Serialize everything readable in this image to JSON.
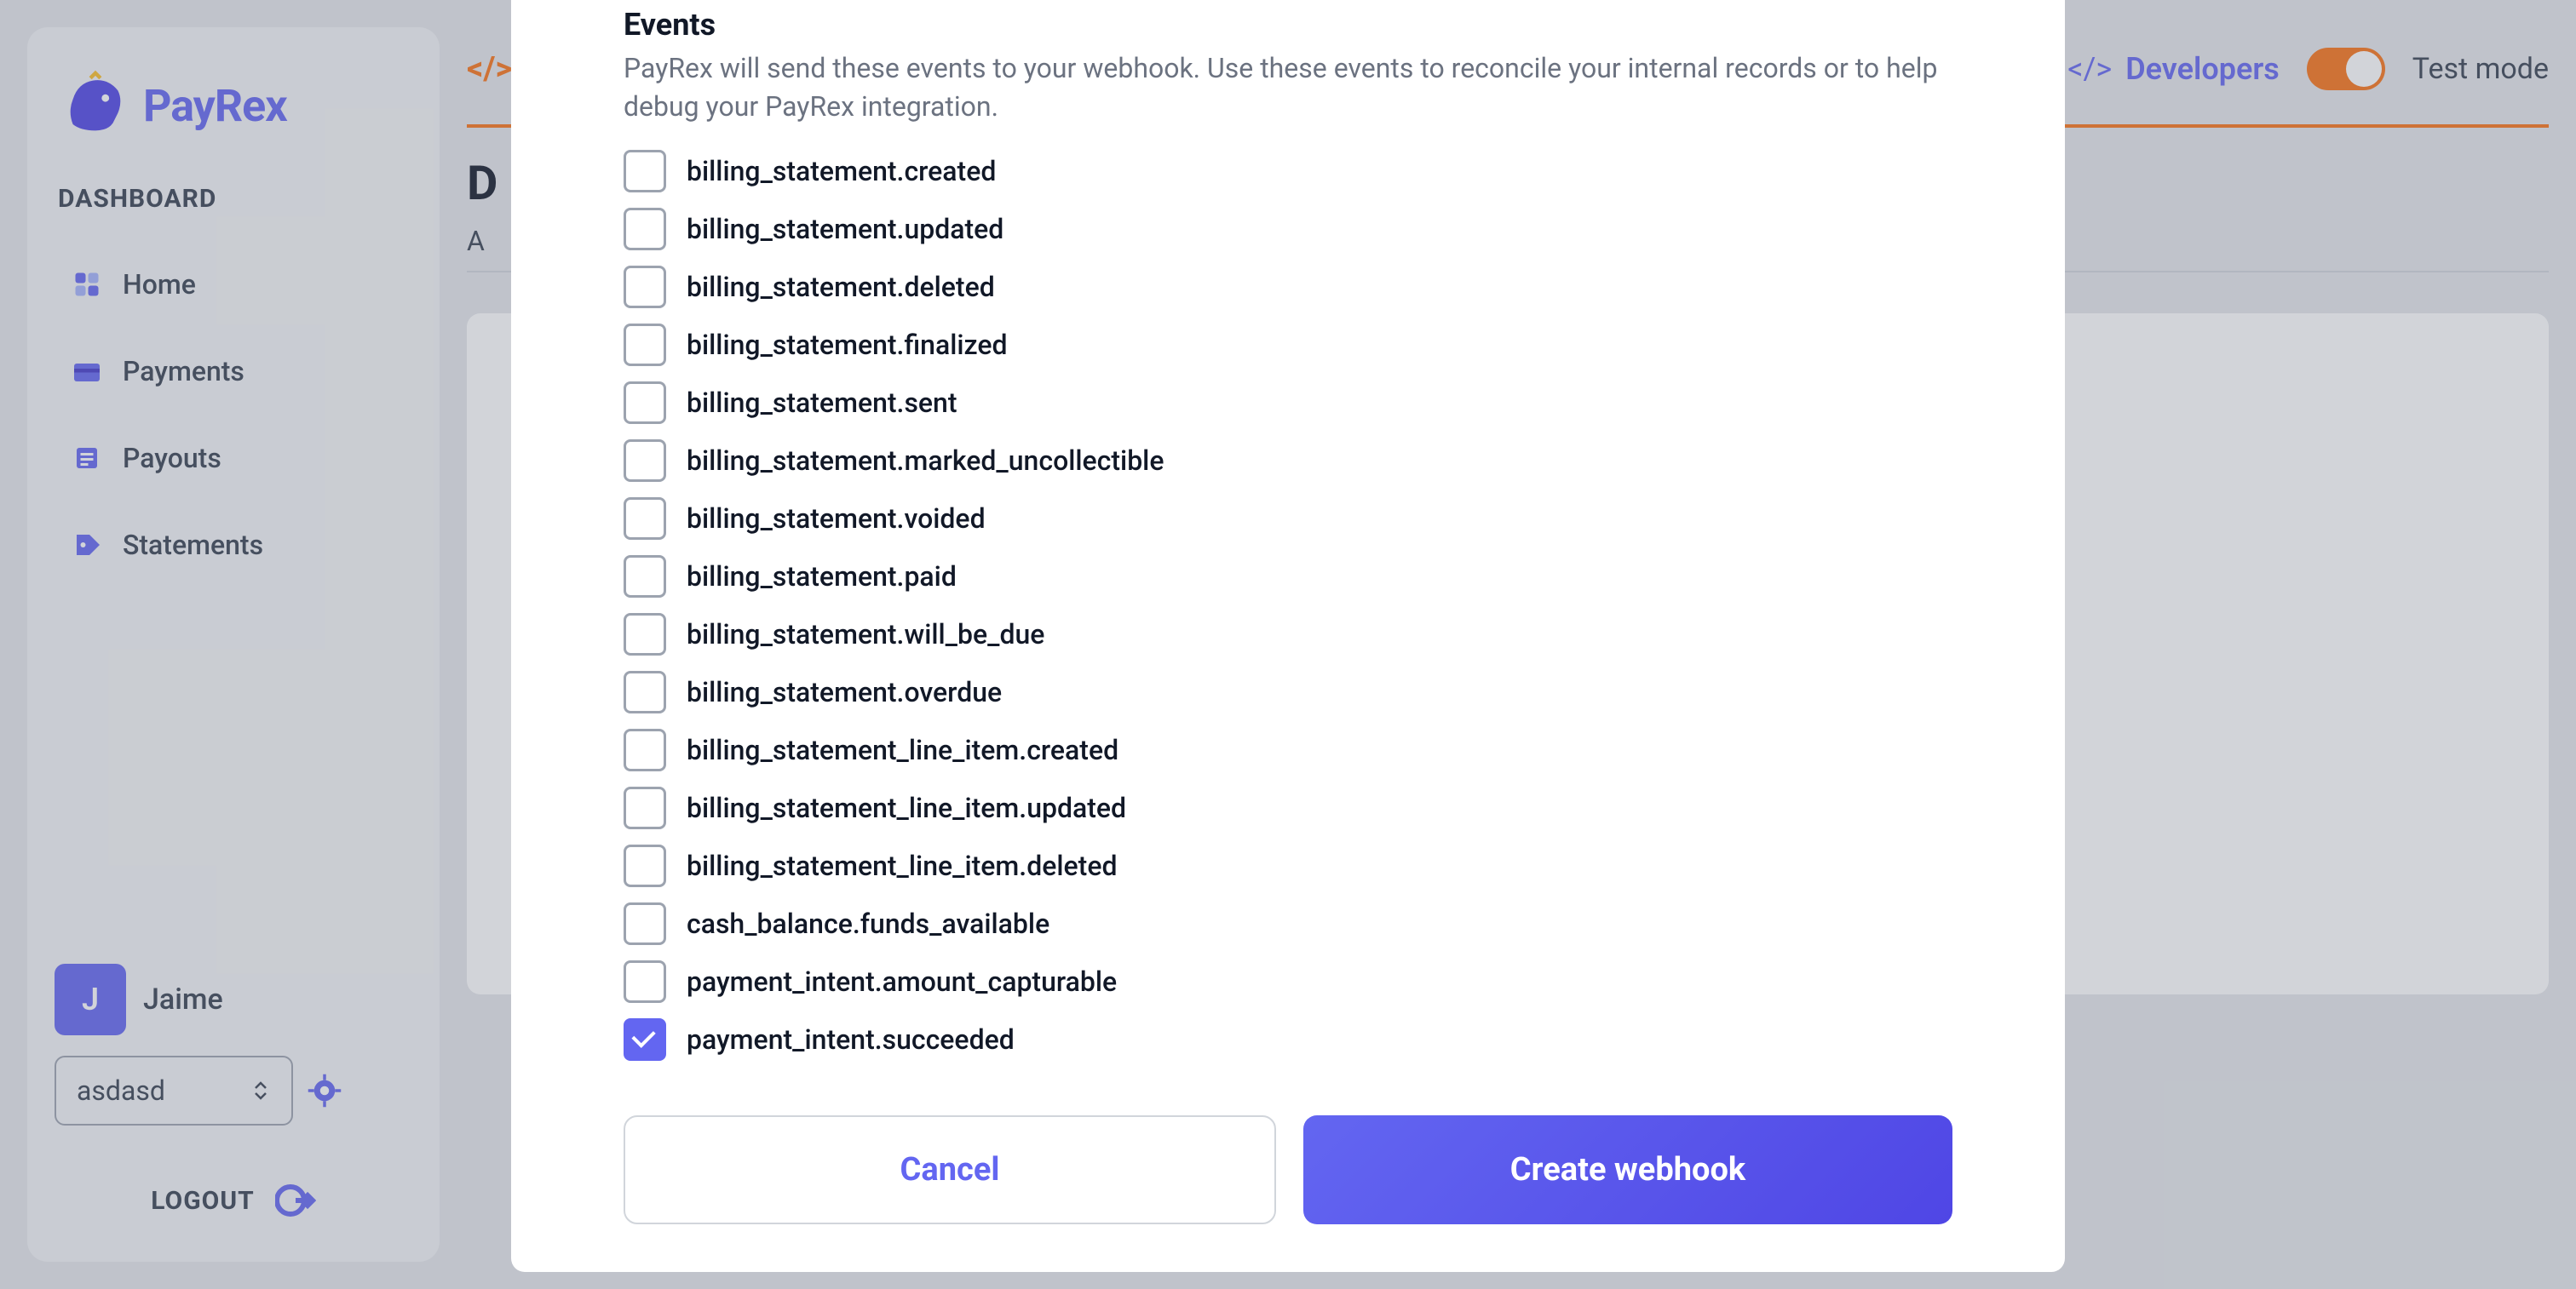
{
  "logo": {
    "text": "PayRex"
  },
  "sidebar": {
    "section_label": "DASHBOARD",
    "nav": [
      {
        "label": "Home",
        "icon": "home-icon"
      },
      {
        "label": "Payments",
        "icon": "card-icon"
      },
      {
        "label": "Payouts",
        "icon": "list-icon"
      },
      {
        "label": "Statements",
        "icon": "tag-icon"
      }
    ],
    "user": {
      "initial": "J",
      "name": "Jaime"
    },
    "selector_value": "asdasd",
    "logout_label": "LOGOUT"
  },
  "topbar": {
    "developers_label": "Developers",
    "test_mode_label": "Test mode"
  },
  "page": {
    "title_initial": "D",
    "tab_initial": "A"
  },
  "modal": {
    "events_title": "Events",
    "events_desc": "PayRex will send these events to your webhook. Use these events to reconcile your internal records or to help debug your PayRex integration.",
    "events": [
      {
        "name": "billing_statement.created",
        "checked": false
      },
      {
        "name": "billing_statement.updated",
        "checked": false
      },
      {
        "name": "billing_statement.deleted",
        "checked": false
      },
      {
        "name": "billing_statement.finalized",
        "checked": false
      },
      {
        "name": "billing_statement.sent",
        "checked": false
      },
      {
        "name": "billing_statement.marked_uncollectible",
        "checked": false
      },
      {
        "name": "billing_statement.voided",
        "checked": false
      },
      {
        "name": "billing_statement.paid",
        "checked": false
      },
      {
        "name": "billing_statement.will_be_due",
        "checked": false
      },
      {
        "name": "billing_statement.overdue",
        "checked": false
      },
      {
        "name": "billing_statement_line_item.created",
        "checked": false
      },
      {
        "name": "billing_statement_line_item.updated",
        "checked": false
      },
      {
        "name": "billing_statement_line_item.deleted",
        "checked": false
      },
      {
        "name": "cash_balance.funds_available",
        "checked": false
      },
      {
        "name": "payment_intent.amount_capturable",
        "checked": false
      },
      {
        "name": "payment_intent.succeeded",
        "checked": true
      }
    ],
    "cancel_label": "Cancel",
    "submit_label": "Create webhook"
  }
}
